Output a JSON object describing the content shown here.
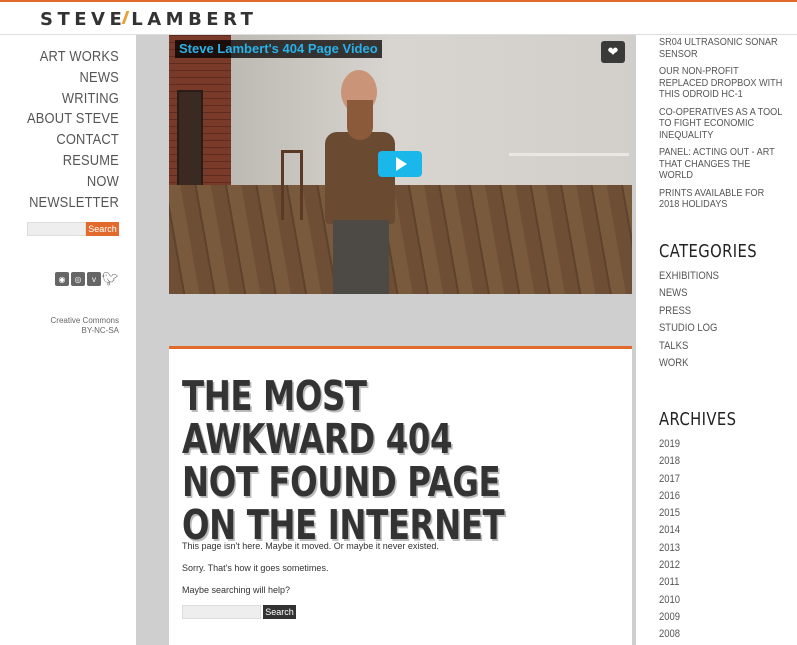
{
  "header": {
    "logo_left": "STEVE",
    "logo_right": "LAMBERT"
  },
  "nav": {
    "items": [
      {
        "label": "ART WORKS"
      },
      {
        "label": "NEWS"
      },
      {
        "label": "WRITING"
      },
      {
        "label": "ABOUT STEVE"
      },
      {
        "label": "CONTACT"
      },
      {
        "label": "RESUME"
      },
      {
        "label": "NOW"
      },
      {
        "label": "NEWSLETTER"
      }
    ],
    "search_button": "Search",
    "social_icons": [
      "rss-icon",
      "instagram-icon",
      "vimeo-icon",
      "twitter-icon"
    ],
    "license_line1": "Creative Commons",
    "license_line2": "BY-NC-SA"
  },
  "video": {
    "title": "Steve Lambert's 404 Page Video",
    "like_icon": "heart-icon",
    "play_icon": "play-icon"
  },
  "article": {
    "headline": "THE MOST AWKWARD 404 NOT FOUND PAGE ON THE INTERNET",
    "p1": "This page isn't here. Maybe it moved. Or maybe it never existed.",
    "p2": "Sorry. That's how it goes sometimes.",
    "p3": "Maybe searching will help?",
    "search_button": "Search"
  },
  "sidebar": {
    "recent_posts": [
      "SR04 ULTRASONIC SONAR SENSOR",
      "OUR NON-PROFIT REPLACED DROPBOX WITH THIS ODROID HC-1",
      "CO-OPERATIVES AS A TOOL TO FIGHT ECONOMIC INEQUALITY",
      "PANEL: ACTING OUT - ART THAT CHANGES THE WORLD",
      "PRINTS AVAILABLE FOR 2018 HOLIDAYS"
    ],
    "categories_title": "CATEGORIES",
    "categories": [
      "EXHIBITIONS",
      "NEWS",
      "PRESS",
      "STUDIO LOG",
      "TALKS",
      "WORK"
    ],
    "archives_title": "ARCHIVES",
    "archives": [
      "2019",
      "2018",
      "2017",
      "2016",
      "2015",
      "2014",
      "2013",
      "2012",
      "2011",
      "2010",
      "2009",
      "2008"
    ]
  },
  "colors": {
    "accent": "#e26a2c",
    "video_title": "#2ab1e8",
    "play_button": "#1ab7ea"
  }
}
